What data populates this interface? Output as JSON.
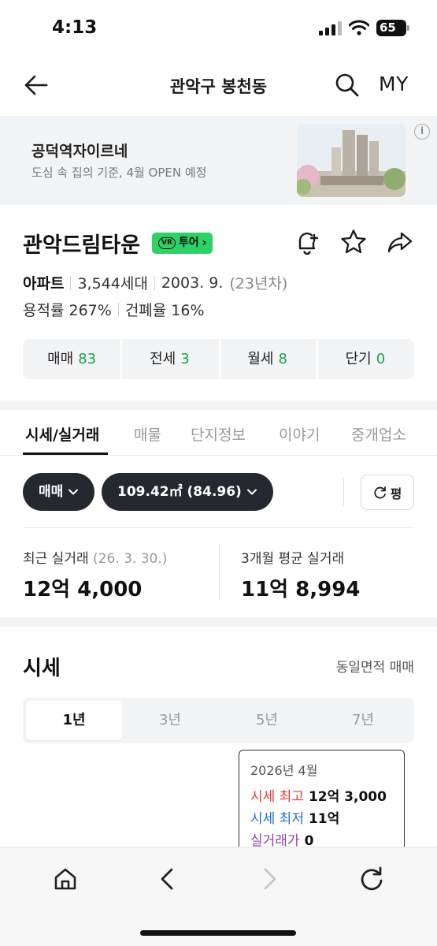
{
  "status_bar": {
    "time": "4:13",
    "battery": "65"
  },
  "header": {
    "title": "관악구 봉천동",
    "my_label": "MY"
  },
  "banner": {
    "title": "공덕역자이르네",
    "subtitle": "도심 속 집의 기준, 4월 OPEN 예정",
    "info": "i"
  },
  "property": {
    "name": "관악드림타운",
    "tour_badge_vr": "VR",
    "tour_badge_label": "투어",
    "type": "아파트",
    "households": "3,544세대",
    "built": "2003. 9.",
    "age": "(23년차)",
    "far": "용적률 267%",
    "bcr": "건폐율 16%"
  },
  "deals": [
    {
      "label": "매매",
      "count": "83"
    },
    {
      "label": "전세",
      "count": "3"
    },
    {
      "label": "월세",
      "count": "8"
    },
    {
      "label": "단기",
      "count": "0"
    }
  ],
  "tabs": [
    "시세/실거래",
    "매물",
    "단지정보",
    "이야기",
    "중개업소"
  ],
  "filters": {
    "deal_type": "매매",
    "area": "109.42㎡ (84.96)",
    "unit_toggle": "평"
  },
  "recent": {
    "label": "최근 실거래",
    "date": "(26. 3. 30.)",
    "value": "12억 4,000"
  },
  "avg3m": {
    "label": "3개월 평균 실거래",
    "value": "11억 8,994"
  },
  "sise": {
    "title": "시세",
    "link": "동일면적 매매",
    "periods": [
      "1년",
      "3년",
      "5년",
      "7년"
    ],
    "selected_period": "1년",
    "tooltip": {
      "date": "2026년 4월",
      "high_label": "시세 최고",
      "high_value": "12억 3,000",
      "low_label": "시세 최저",
      "low_value": "11억",
      "deal_label": "실거래가",
      "deal_value": "0"
    }
  },
  "colors": {
    "accent_green": "#1aa34a",
    "badge_green": "#2dd164",
    "high_red": "#e53935",
    "low_blue": "#1e6fd9",
    "deal_purple": "#8e44ad"
  }
}
